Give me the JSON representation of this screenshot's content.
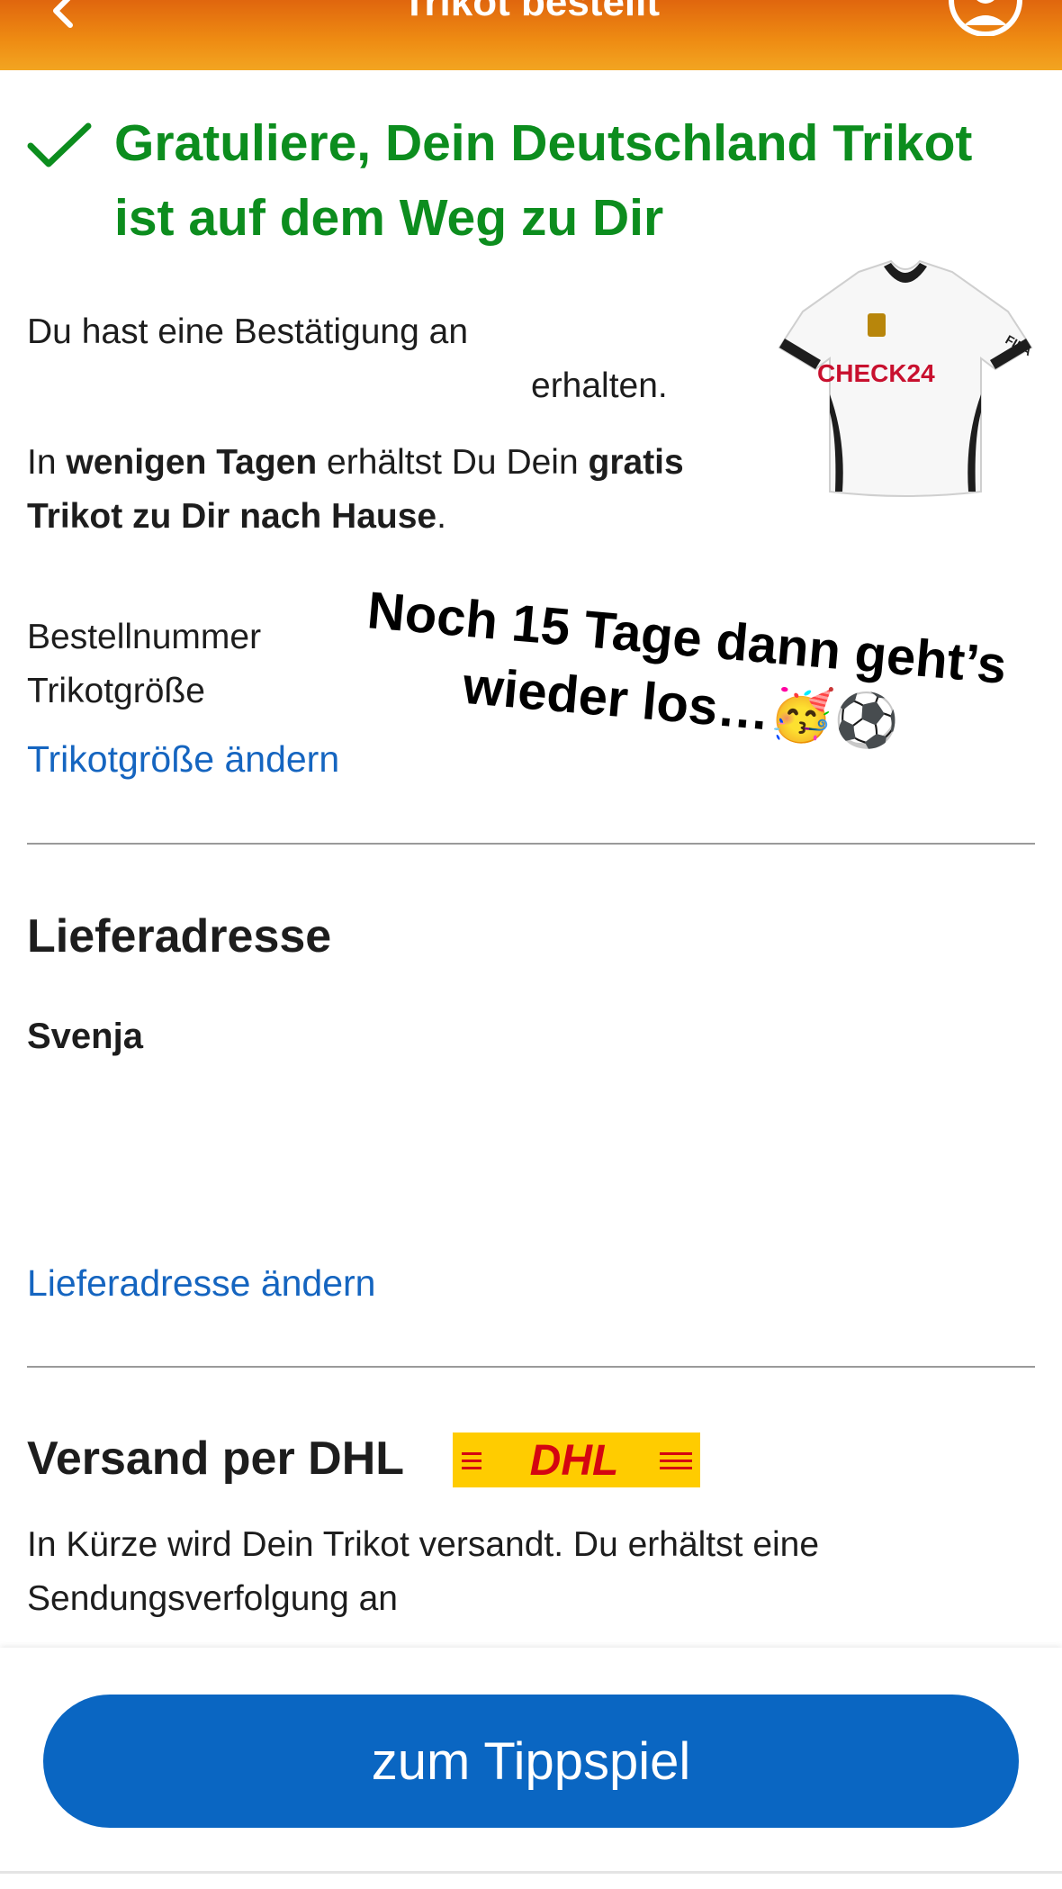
{
  "header": {
    "title": "Trikot bestellt"
  },
  "success": {
    "title": "Gratuliere, Dein Deutschland Trikot ist auf dem Weg zu Dir"
  },
  "confirmation": {
    "text_start": "Du hast eine Bestätigung an",
    "text_end": "erhalten."
  },
  "delivery_info": {
    "part1": "In ",
    "part2": "wenigen Tagen",
    "part3": " erhältst Du Dein ",
    "part4": "gratis Trikot zu Dir nach Hause",
    "part5": "."
  },
  "jersey": {
    "brand": "CHECK24",
    "maker": "FILA"
  },
  "order": {
    "number_label": "Bestellnummer",
    "size_label": "Trikotgröße",
    "change_size_link": "Trikotgröße ändern"
  },
  "overlay": {
    "line1": "Noch 15 Tage dann geht’s",
    "line2": "wieder los…🥳⚽"
  },
  "address": {
    "heading": "Lieferadresse",
    "name": "Svenja",
    "change_link": "Lieferadresse ändern"
  },
  "shipping": {
    "heading": "Versand per DHL",
    "logo_text": "DHL",
    "logo_color": "#ffcc00",
    "logo_text_color": "#d40511",
    "text": "In Kürze wird Dein Trikot versandt. Du erhältst eine Sendungsverfolgung an"
  },
  "cta": {
    "label": "zum Tippspiel"
  },
  "colors": {
    "header": "#ee8a12",
    "success": "#0c8d1e",
    "link": "#1565c0",
    "button": "#0a66c2"
  }
}
